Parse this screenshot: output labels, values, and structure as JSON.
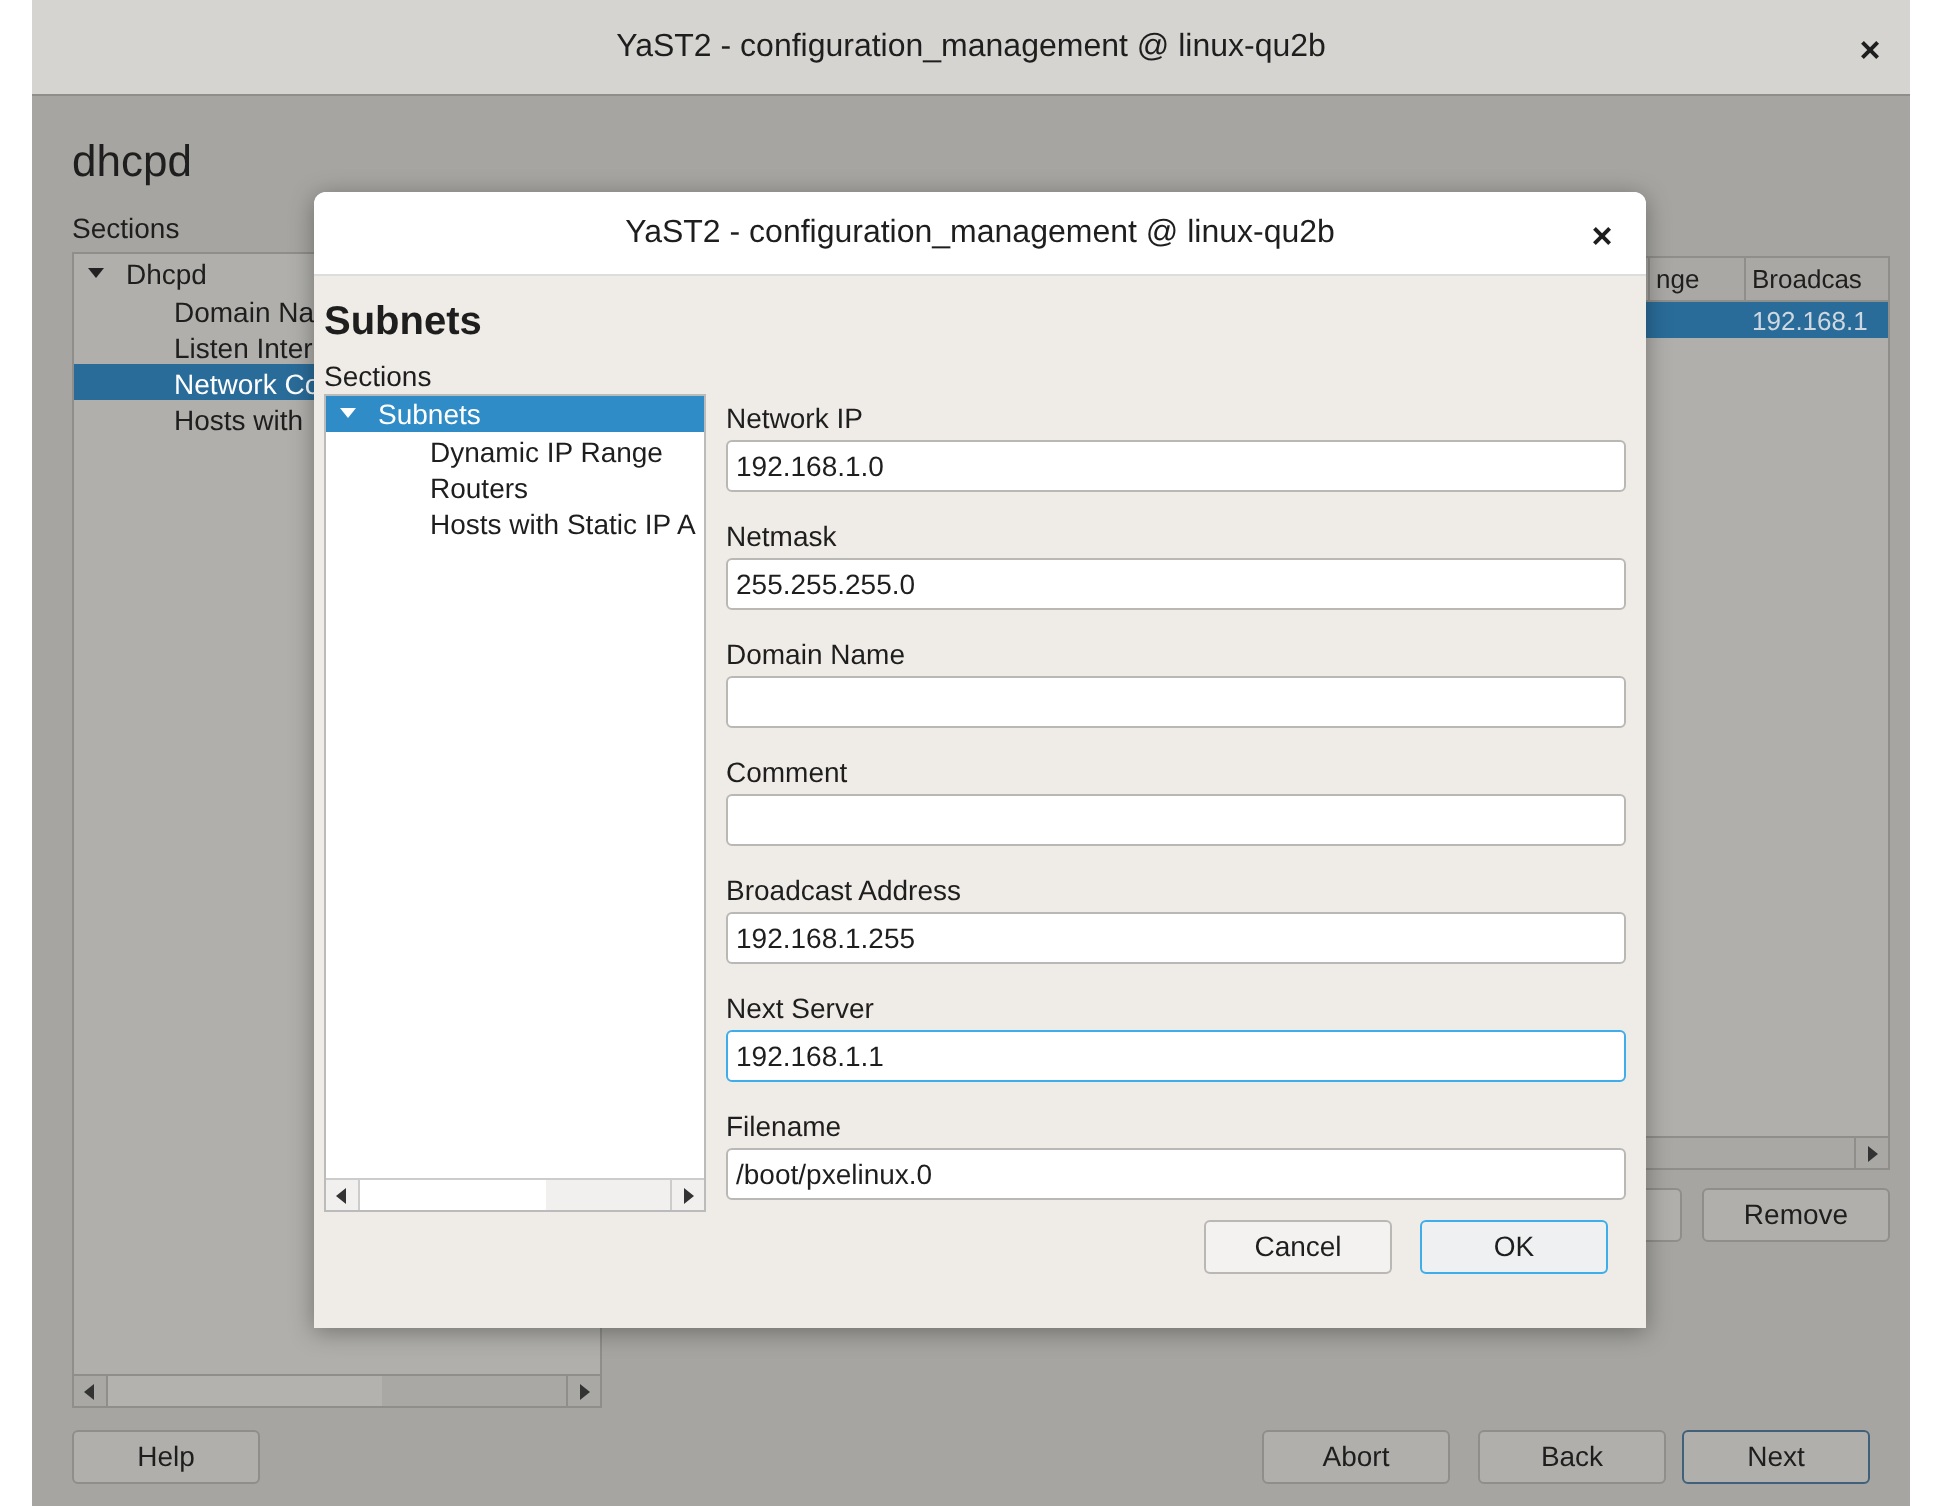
{
  "window": {
    "title": "YaST2 - configuration_management @ linux-qu2b",
    "close": "×"
  },
  "heading": "dhcpd",
  "sections_label": "Sections",
  "tree": [
    {
      "label": "Dhcpd",
      "expanded": true,
      "selected": false,
      "children": [
        {
          "label": "Domain Na",
          "selected": false
        },
        {
          "label": "Listen Inter",
          "selected": false
        },
        {
          "label": "Network Co",
          "selected": true
        },
        {
          "label": "Hosts with",
          "selected": false
        }
      ]
    }
  ],
  "table": {
    "columns": [
      "nge",
      "Broadcas"
    ],
    "rows": [
      {
        "selected": true,
        "cells": [
          "",
          "192.168.1"
        ]
      }
    ]
  },
  "table_buttons": [
    "Remove"
  ],
  "footer_buttons": [
    {
      "label": "Help",
      "focused": false
    },
    {
      "label": "Abort",
      "focused": false
    },
    {
      "label": "Back",
      "focused": false
    },
    {
      "label": "Next",
      "focused": true
    }
  ],
  "dialog": {
    "title": "YaST2 - configuration_management @ linux-qu2b",
    "close": "×",
    "heading": "Subnets",
    "sections_label": "Sections",
    "tree": [
      {
        "label": "Subnets",
        "expanded": true,
        "selected": true,
        "children": [
          {
            "label": "Dynamic IP Range",
            "selected": false
          },
          {
            "label": "Routers",
            "selected": false
          },
          {
            "label": "Hosts with Static IP A",
            "selected": false
          }
        ]
      }
    ],
    "fields": [
      {
        "label": "Network IP",
        "value": "192.168.1.0",
        "focused": false
      },
      {
        "label": "Netmask",
        "value": "255.255.255.0",
        "focused": false
      },
      {
        "label": "Domain Name",
        "focused": false
      },
      {
        "label": "Comment",
        "focused": false
      },
      {
        "label": "Broadcast Address",
        "value": "192.168.1.255",
        "focused": false
      },
      {
        "label": "Next Server",
        "value": "192.168.1.1",
        "focused": true
      },
      {
        "label": "Filename",
        "value": "/boot/pxelinux.0",
        "focused": false
      }
    ],
    "buttons": [
      {
        "label": "Cancel",
        "default": false
      },
      {
        "label": "OK",
        "default": true
      }
    ]
  }
}
